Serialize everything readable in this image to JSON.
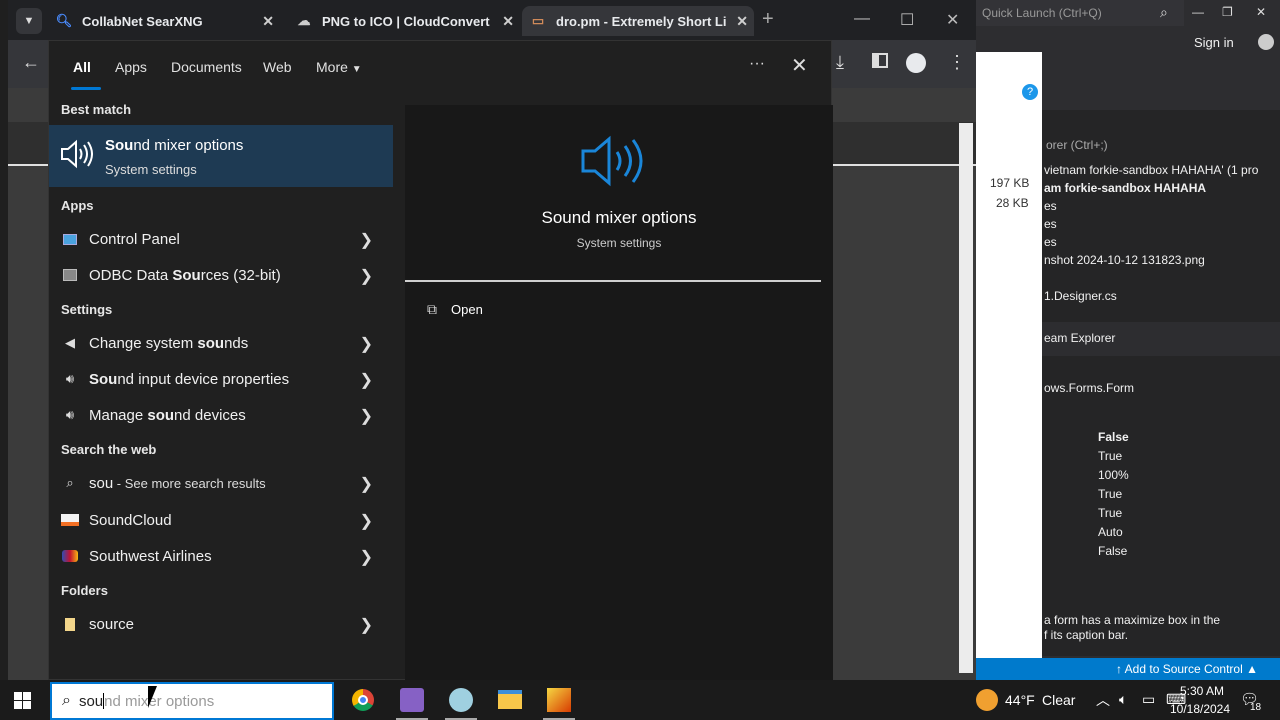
{
  "browser": {
    "tabs": [
      {
        "title": "CollabNet SearXNG",
        "icon": "search-icon"
      },
      {
        "title": "PNG to ICO | CloudConvert",
        "icon": "cloud-icon"
      },
      {
        "title": "dro.pm - Extremely Short Link",
        "icon": "folder-icon"
      }
    ]
  },
  "vs": {
    "quick_launch": "Quick Launch (Ctrl+Q)",
    "sign_in": "Sign in",
    "search_solution": "orer (Ctrl+;)",
    "tree": [
      "vietnam forkie-sandbox HAHAHA' (1 pro",
      "am forkie-sandbox HAHAHA",
      "es",
      "es",
      "es",
      "nshot 2024-10-12 131823.png",
      "1.Designer.cs"
    ],
    "team_explorer": "eam Explorer",
    "props_object": "ows.Forms.Form",
    "props_values": [
      "False",
      "True",
      "100%",
      "True",
      "True",
      "Auto",
      "False"
    ],
    "description": [
      "a form has a maximize box in the",
      "f its caption bar."
    ],
    "sizes": [
      "197 KB",
      "28 KB"
    ],
    "status": "Add to Source Control"
  },
  "search": {
    "tabs": [
      "All",
      "Apps",
      "Documents",
      "Web",
      "More"
    ],
    "best_match_header": "Best match",
    "best_match": {
      "title_bold": "Sou",
      "title_rest": "nd mixer options",
      "subtitle": "System settings"
    },
    "apps_header": "Apps",
    "apps": [
      {
        "pre": "",
        "bold": "",
        "post": "Control Panel"
      },
      {
        "pre": "ODBC Data ",
        "bold": "Sou",
        "post": "rces (32-bit)"
      }
    ],
    "settings_header": "Settings",
    "settings": [
      {
        "pre": "Change system ",
        "bold": "sou",
        "post": "nds"
      },
      {
        "pre": "",
        "bold": "Sou",
        "post": "nd input device properties"
      },
      {
        "pre": "Manage ",
        "bold": "sou",
        "post": "nd devices"
      }
    ],
    "web_header": "Search the web",
    "web": [
      {
        "bold": "sou",
        "rest": " - See more search results"
      },
      {
        "bold": "",
        "rest": "SoundCloud"
      },
      {
        "bold": "",
        "rest": "Southwest Airlines"
      }
    ],
    "folders_header": "Folders",
    "folders": [
      {
        "pre": "",
        "bold": "sou",
        "post": "rce"
      }
    ],
    "preview": {
      "title": "Sound mixer options",
      "subtitle": "System settings",
      "open": "Open"
    },
    "input_typed": "sou",
    "input_ghost": "nd mixer options"
  },
  "taskbar": {
    "weather_temp": "44°F",
    "weather_desc": "Clear",
    "time": "5:30 AM",
    "date": "10/18/2024",
    "notif_count": "18"
  },
  "colors": {
    "accent": "#0078d4",
    "selected": "#1e3a53",
    "vs_blue": "#007acc"
  }
}
